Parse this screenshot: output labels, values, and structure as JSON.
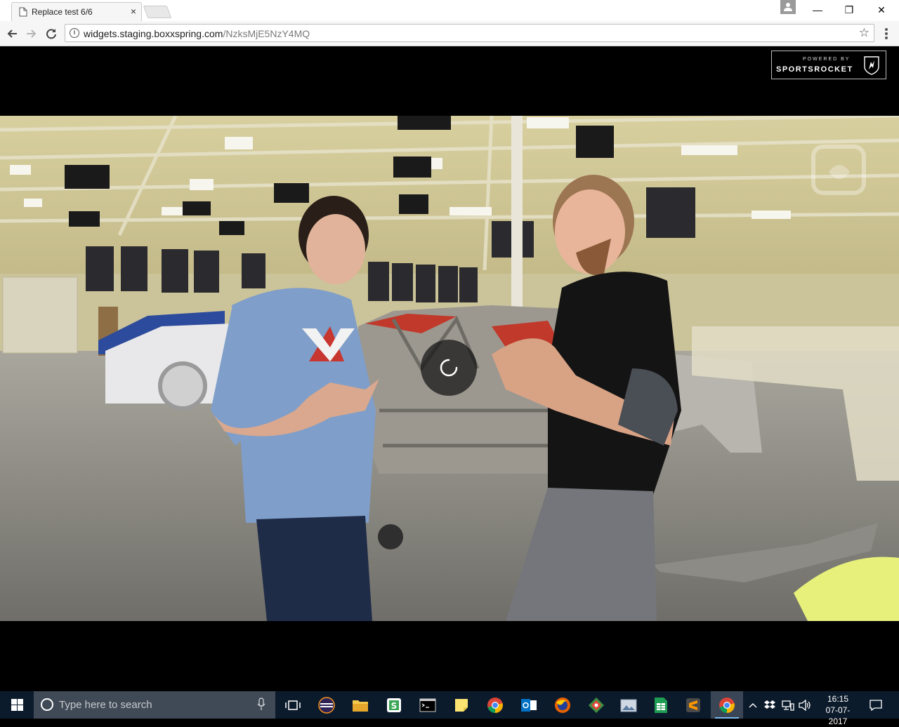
{
  "browser": {
    "tab_title": "Replace test 6/6",
    "tab_close": "×",
    "url_domain": "widgets.staging.boxxspring.com",
    "url_path": "/NzksMjE5NzY4MQ",
    "info_glyph": "i",
    "star_glyph": "☆",
    "window_controls": {
      "minimize": "—",
      "maximize": "❐",
      "close": "✕"
    }
  },
  "player": {
    "logo_powered": "POWERED BY",
    "logo_name": "SPORTSROCKET",
    "state": "loading"
  },
  "taskbar": {
    "search_placeholder": "Type here to search",
    "apps": [
      "task-view",
      "eclipse",
      "file-explorer",
      "slack",
      "cmd",
      "sticky-notes",
      "chrome",
      "outlook",
      "firefox",
      "git",
      "image-viewer",
      "sheets",
      "sublime-text",
      "chrome-active"
    ],
    "time": "16:15",
    "date": "07-07-2017"
  }
}
